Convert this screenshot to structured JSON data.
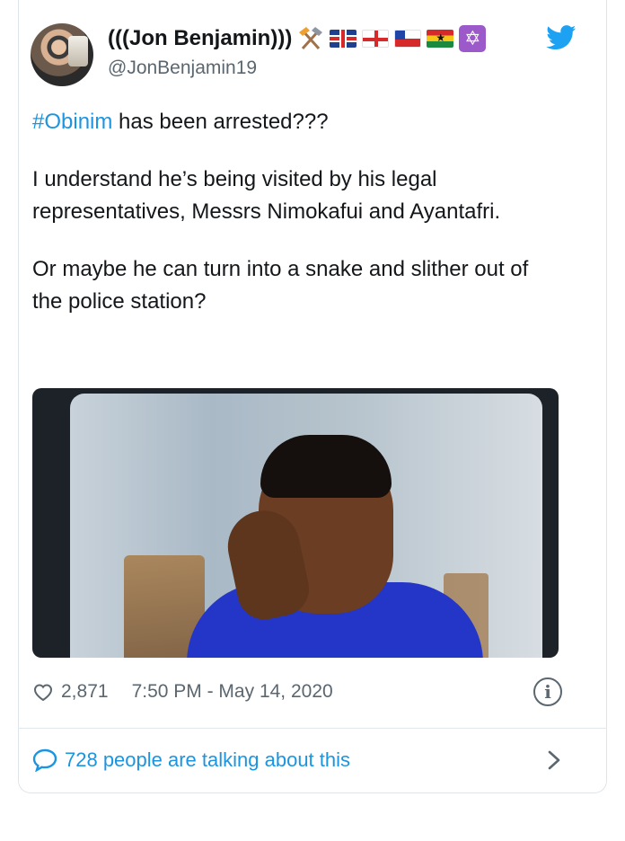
{
  "user": {
    "display_name": "(((Jon Benjamin)))",
    "handle": "@JonBenjamin19",
    "badge_icons": [
      "hammer-pick-icon",
      "uk-flag-icon",
      "england-flag-icon",
      "chile-flag-icon",
      "ghana-flag-icon",
      "star-of-david-icon"
    ]
  },
  "tweet": {
    "hashtag": "#Obinim",
    "line1_rest": " has been arrested???",
    "paragraph2": "I understand he’s being visited by his legal representatives, Messrs Nimokafui and Ayantafri.",
    "paragraph3": "Or maybe he can turn into a snake and slither out of the police station?"
  },
  "footer": {
    "likes": "2,871",
    "timestamp": "7:50 PM - May 14, 2020",
    "info_icon": "i"
  },
  "conversation": {
    "label": "728 people are talking about this"
  },
  "colors": {
    "accent": "#1b95e0",
    "text": "#14171a",
    "muted": "#5b6770"
  }
}
